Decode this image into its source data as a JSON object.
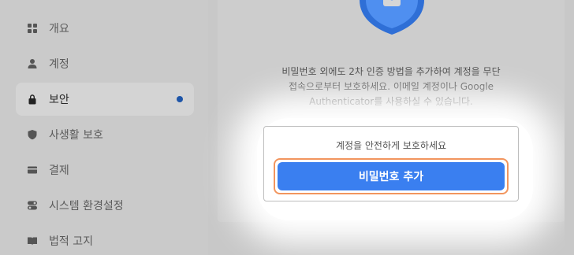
{
  "sidebar": {
    "items": [
      {
        "label": "개요",
        "icon": "grid-icon",
        "active": false
      },
      {
        "label": "계정",
        "icon": "person-icon",
        "active": false
      },
      {
        "label": "보안",
        "icon": "lock-icon",
        "active": true
      },
      {
        "label": "사생활 보호",
        "icon": "shield-icon",
        "active": false
      },
      {
        "label": "결제",
        "icon": "card-icon",
        "active": false
      },
      {
        "label": "시스템 환경설정",
        "icon": "toggle-icon",
        "active": false
      },
      {
        "label": "법적 고지",
        "icon": "book-icon",
        "active": false
      }
    ]
  },
  "security": {
    "description_line1": "비밀번호 외에도 2차 인증 방법을 추가하여 계정을 무단",
    "description_line2": "접속으로부터 보호하세요. 이메일 계정이나 Google",
    "description_line3": "Authenticator를 사용하실 수 있습니다.",
    "box_caption": "계정을 안전하게 보호하세요",
    "add_password_label": "비밀번호 추가"
  },
  "colors": {
    "accent": "#3a7ff0",
    "highlight_ring": "#f2955e",
    "active_dot": "#1e55a8",
    "shield": "#2f6fd6"
  }
}
